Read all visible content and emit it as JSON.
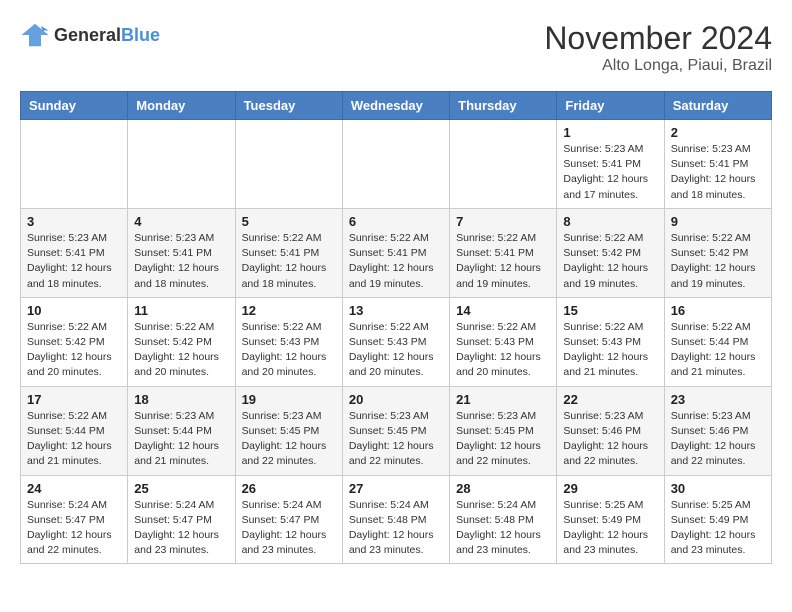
{
  "header": {
    "logo_line1": "General",
    "logo_line2": "Blue",
    "month": "November 2024",
    "location": "Alto Longa, Piaui, Brazil"
  },
  "weekdays": [
    "Sunday",
    "Monday",
    "Tuesday",
    "Wednesday",
    "Thursday",
    "Friday",
    "Saturday"
  ],
  "weeks": [
    [
      {
        "day": "",
        "info": ""
      },
      {
        "day": "",
        "info": ""
      },
      {
        "day": "",
        "info": ""
      },
      {
        "day": "",
        "info": ""
      },
      {
        "day": "",
        "info": ""
      },
      {
        "day": "1",
        "info": "Sunrise: 5:23 AM\nSunset: 5:41 PM\nDaylight: 12 hours\nand 17 minutes."
      },
      {
        "day": "2",
        "info": "Sunrise: 5:23 AM\nSunset: 5:41 PM\nDaylight: 12 hours\nand 18 minutes."
      }
    ],
    [
      {
        "day": "3",
        "info": "Sunrise: 5:23 AM\nSunset: 5:41 PM\nDaylight: 12 hours\nand 18 minutes."
      },
      {
        "day": "4",
        "info": "Sunrise: 5:23 AM\nSunset: 5:41 PM\nDaylight: 12 hours\nand 18 minutes."
      },
      {
        "day": "5",
        "info": "Sunrise: 5:22 AM\nSunset: 5:41 PM\nDaylight: 12 hours\nand 18 minutes."
      },
      {
        "day": "6",
        "info": "Sunrise: 5:22 AM\nSunset: 5:41 PM\nDaylight: 12 hours\nand 19 minutes."
      },
      {
        "day": "7",
        "info": "Sunrise: 5:22 AM\nSunset: 5:41 PM\nDaylight: 12 hours\nand 19 minutes."
      },
      {
        "day": "8",
        "info": "Sunrise: 5:22 AM\nSunset: 5:42 PM\nDaylight: 12 hours\nand 19 minutes."
      },
      {
        "day": "9",
        "info": "Sunrise: 5:22 AM\nSunset: 5:42 PM\nDaylight: 12 hours\nand 19 minutes."
      }
    ],
    [
      {
        "day": "10",
        "info": "Sunrise: 5:22 AM\nSunset: 5:42 PM\nDaylight: 12 hours\nand 20 minutes."
      },
      {
        "day": "11",
        "info": "Sunrise: 5:22 AM\nSunset: 5:42 PM\nDaylight: 12 hours\nand 20 minutes."
      },
      {
        "day": "12",
        "info": "Sunrise: 5:22 AM\nSunset: 5:43 PM\nDaylight: 12 hours\nand 20 minutes."
      },
      {
        "day": "13",
        "info": "Sunrise: 5:22 AM\nSunset: 5:43 PM\nDaylight: 12 hours\nand 20 minutes."
      },
      {
        "day": "14",
        "info": "Sunrise: 5:22 AM\nSunset: 5:43 PM\nDaylight: 12 hours\nand 20 minutes."
      },
      {
        "day": "15",
        "info": "Sunrise: 5:22 AM\nSunset: 5:43 PM\nDaylight: 12 hours\nand 21 minutes."
      },
      {
        "day": "16",
        "info": "Sunrise: 5:22 AM\nSunset: 5:44 PM\nDaylight: 12 hours\nand 21 minutes."
      }
    ],
    [
      {
        "day": "17",
        "info": "Sunrise: 5:22 AM\nSunset: 5:44 PM\nDaylight: 12 hours\nand 21 minutes."
      },
      {
        "day": "18",
        "info": "Sunrise: 5:23 AM\nSunset: 5:44 PM\nDaylight: 12 hours\nand 21 minutes."
      },
      {
        "day": "19",
        "info": "Sunrise: 5:23 AM\nSunset: 5:45 PM\nDaylight: 12 hours\nand 22 minutes."
      },
      {
        "day": "20",
        "info": "Sunrise: 5:23 AM\nSunset: 5:45 PM\nDaylight: 12 hours\nand 22 minutes."
      },
      {
        "day": "21",
        "info": "Sunrise: 5:23 AM\nSunset: 5:45 PM\nDaylight: 12 hours\nand 22 minutes."
      },
      {
        "day": "22",
        "info": "Sunrise: 5:23 AM\nSunset: 5:46 PM\nDaylight: 12 hours\nand 22 minutes."
      },
      {
        "day": "23",
        "info": "Sunrise: 5:23 AM\nSunset: 5:46 PM\nDaylight: 12 hours\nand 22 minutes."
      }
    ],
    [
      {
        "day": "24",
        "info": "Sunrise: 5:24 AM\nSunset: 5:47 PM\nDaylight: 12 hours\nand 22 minutes."
      },
      {
        "day": "25",
        "info": "Sunrise: 5:24 AM\nSunset: 5:47 PM\nDaylight: 12 hours\nand 23 minutes."
      },
      {
        "day": "26",
        "info": "Sunrise: 5:24 AM\nSunset: 5:47 PM\nDaylight: 12 hours\nand 23 minutes."
      },
      {
        "day": "27",
        "info": "Sunrise: 5:24 AM\nSunset: 5:48 PM\nDaylight: 12 hours\nand 23 minutes."
      },
      {
        "day": "28",
        "info": "Sunrise: 5:24 AM\nSunset: 5:48 PM\nDaylight: 12 hours\nand 23 minutes."
      },
      {
        "day": "29",
        "info": "Sunrise: 5:25 AM\nSunset: 5:49 PM\nDaylight: 12 hours\nand 23 minutes."
      },
      {
        "day": "30",
        "info": "Sunrise: 5:25 AM\nSunset: 5:49 PM\nDaylight: 12 hours\nand 23 minutes."
      }
    ]
  ]
}
